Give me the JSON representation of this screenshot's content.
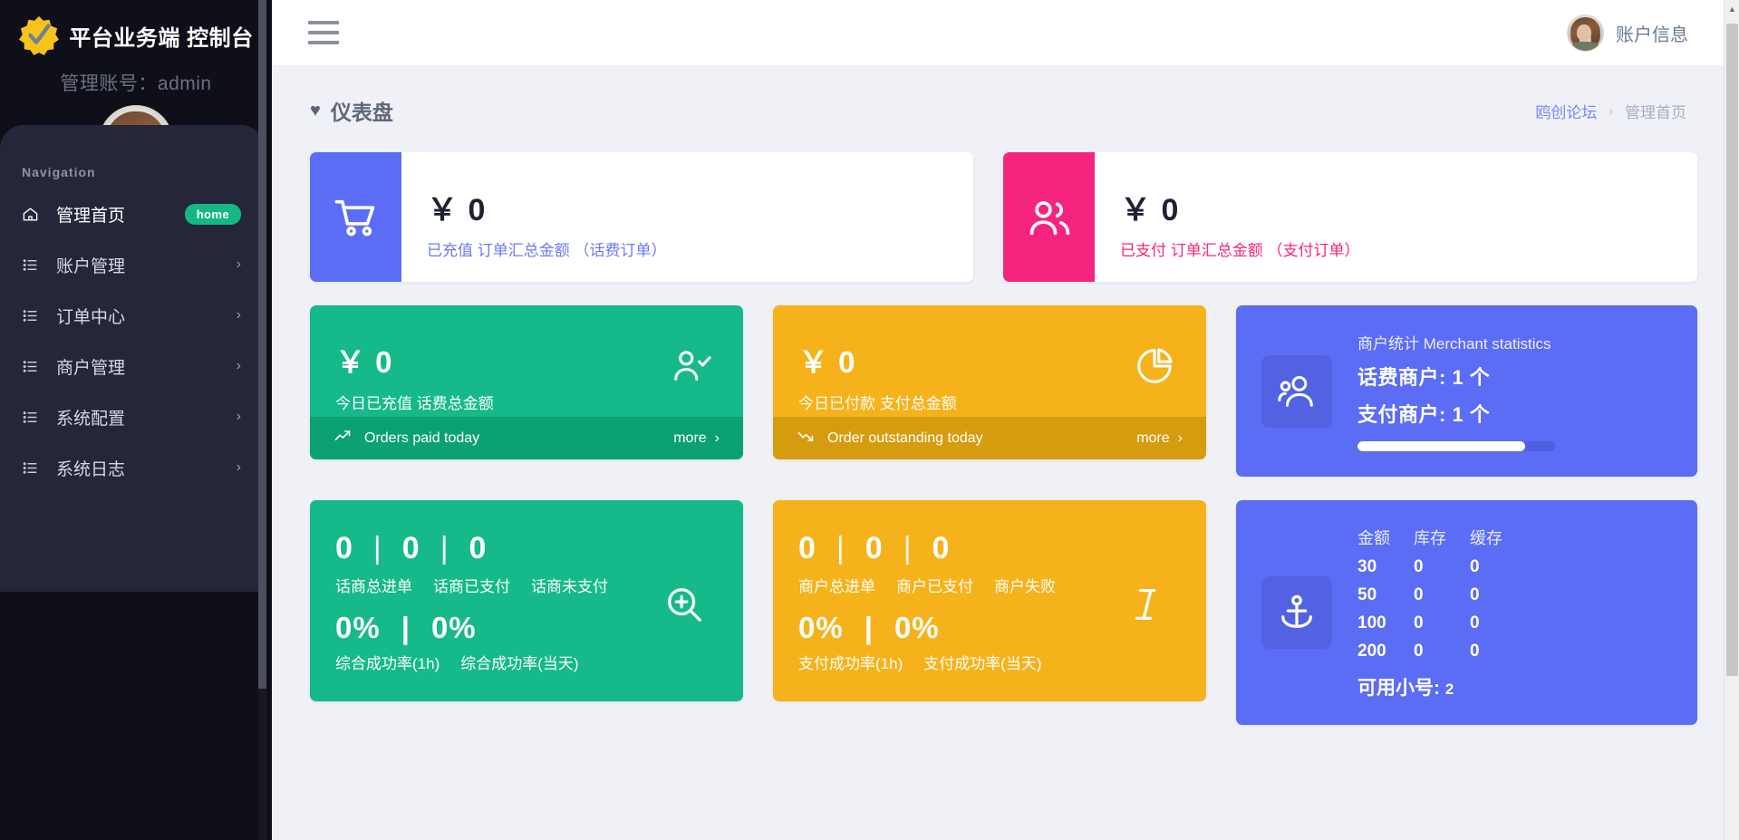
{
  "sidebar": {
    "brand": "平台业务端 控制台",
    "account_line": "管理账号：admin",
    "nav_label": "Navigation",
    "items": [
      {
        "label": "管理首页",
        "icon": "home-icon",
        "badge": "home",
        "active": true
      },
      {
        "label": "账户管理",
        "icon": "list-icon",
        "chevron": "›"
      },
      {
        "label": "订单中心",
        "icon": "list-icon",
        "chevron": "›"
      },
      {
        "label": "商户管理",
        "icon": "list-icon",
        "chevron": "›"
      },
      {
        "label": "系统配置",
        "icon": "list-icon",
        "chevron": "›"
      },
      {
        "label": "系统日志",
        "icon": "list-icon",
        "chevron": "›"
      }
    ]
  },
  "topbar": {
    "menu_icon": "hamburger-icon",
    "account_label": "账户信息",
    "avatar": "user-avatar"
  },
  "page": {
    "title": "仪表盘",
    "title_icon": "heart-icon",
    "breadcrumb": {
      "link": "鸥创论坛",
      "separator": "›",
      "current": "管理首页"
    }
  },
  "summary_cards": [
    {
      "icon": "shopping-cart-icon",
      "icon_color": "#5b6cf5",
      "amount": "￥ 0",
      "caption": "已充值 订单汇总金额 （话费订单）",
      "caption_color": "#6b7bf0"
    },
    {
      "icon": "users-icon",
      "icon_color": "#f5257f",
      "amount": "￥ 0",
      "caption": "已支付 订单汇总金额 （支付订单）",
      "caption_color": "#f5257f"
    }
  ],
  "today_tiles": [
    {
      "color": "#16b98a",
      "footer_color": "#0ba173",
      "amount": "￥ 0",
      "label": "今日已充值 话费总金额",
      "icon": "user-check-icon",
      "footer_icon": "trend-up-icon",
      "footer_text": "Orders paid today",
      "more_label": "more",
      "more_chevron": "›"
    },
    {
      "color": "#f6b21b",
      "footer_color": "#d69c10",
      "amount": "￥ 0",
      "label": "今日已付款 支付总金额",
      "icon": "pie-chart-icon",
      "footer_icon": "trend-down-icon",
      "footer_text": "Order outstanding today",
      "more_label": "more",
      "more_chevron": "›"
    }
  ],
  "merchant_stats": {
    "icon": "people-icon",
    "title": "商户统计 Merchant statistics",
    "lines": [
      "话费商户: 1 个",
      "支付商户: 1 个"
    ],
    "progress_percent": 85
  },
  "detail_tiles": [
    {
      "color": "#16b98a",
      "nums": [
        "0",
        "0",
        "0"
      ],
      "num_labels": [
        "话商总进单",
        "话商已支付",
        "话商未支付"
      ],
      "pcts": [
        "0%",
        "0%"
      ],
      "pct_labels": [
        "综合成功率(1h)",
        "综合成功率(当天)"
      ],
      "icon": "zoom-in-icon",
      "separator": "|"
    },
    {
      "color": "#f6b21b",
      "nums": [
        "0",
        "0",
        "0"
      ],
      "num_labels": [
        "商户总进单",
        "商户已支付",
        "商户失败"
      ],
      "pcts": [
        "0%",
        "0%"
      ],
      "pct_labels": [
        "支付成功率(1h)",
        "支付成功率(当天)"
      ],
      "icon": "text-cursor-icon",
      "separator": "|"
    }
  ],
  "stock_table": {
    "icon": "anchor-icon",
    "headers": [
      "金额",
      "库存",
      "缓存"
    ],
    "rows": [
      [
        "30",
        "0",
        "0"
      ],
      [
        "50",
        "0",
        "0"
      ],
      [
        "100",
        "0",
        "0"
      ],
      [
        "200",
        "0",
        "0"
      ]
    ],
    "available_label": "可用小号:",
    "available_value": "2"
  },
  "colors": {
    "sidebar_bg": "#0e0f18",
    "sidebar_panel": "#252639",
    "accent_blue": "#5b6cf5",
    "accent_pink": "#f5257f",
    "accent_green": "#16b98a",
    "accent_amber": "#f6b21b",
    "badge_green": "#15b884",
    "page_bg": "#eff1f7"
  }
}
